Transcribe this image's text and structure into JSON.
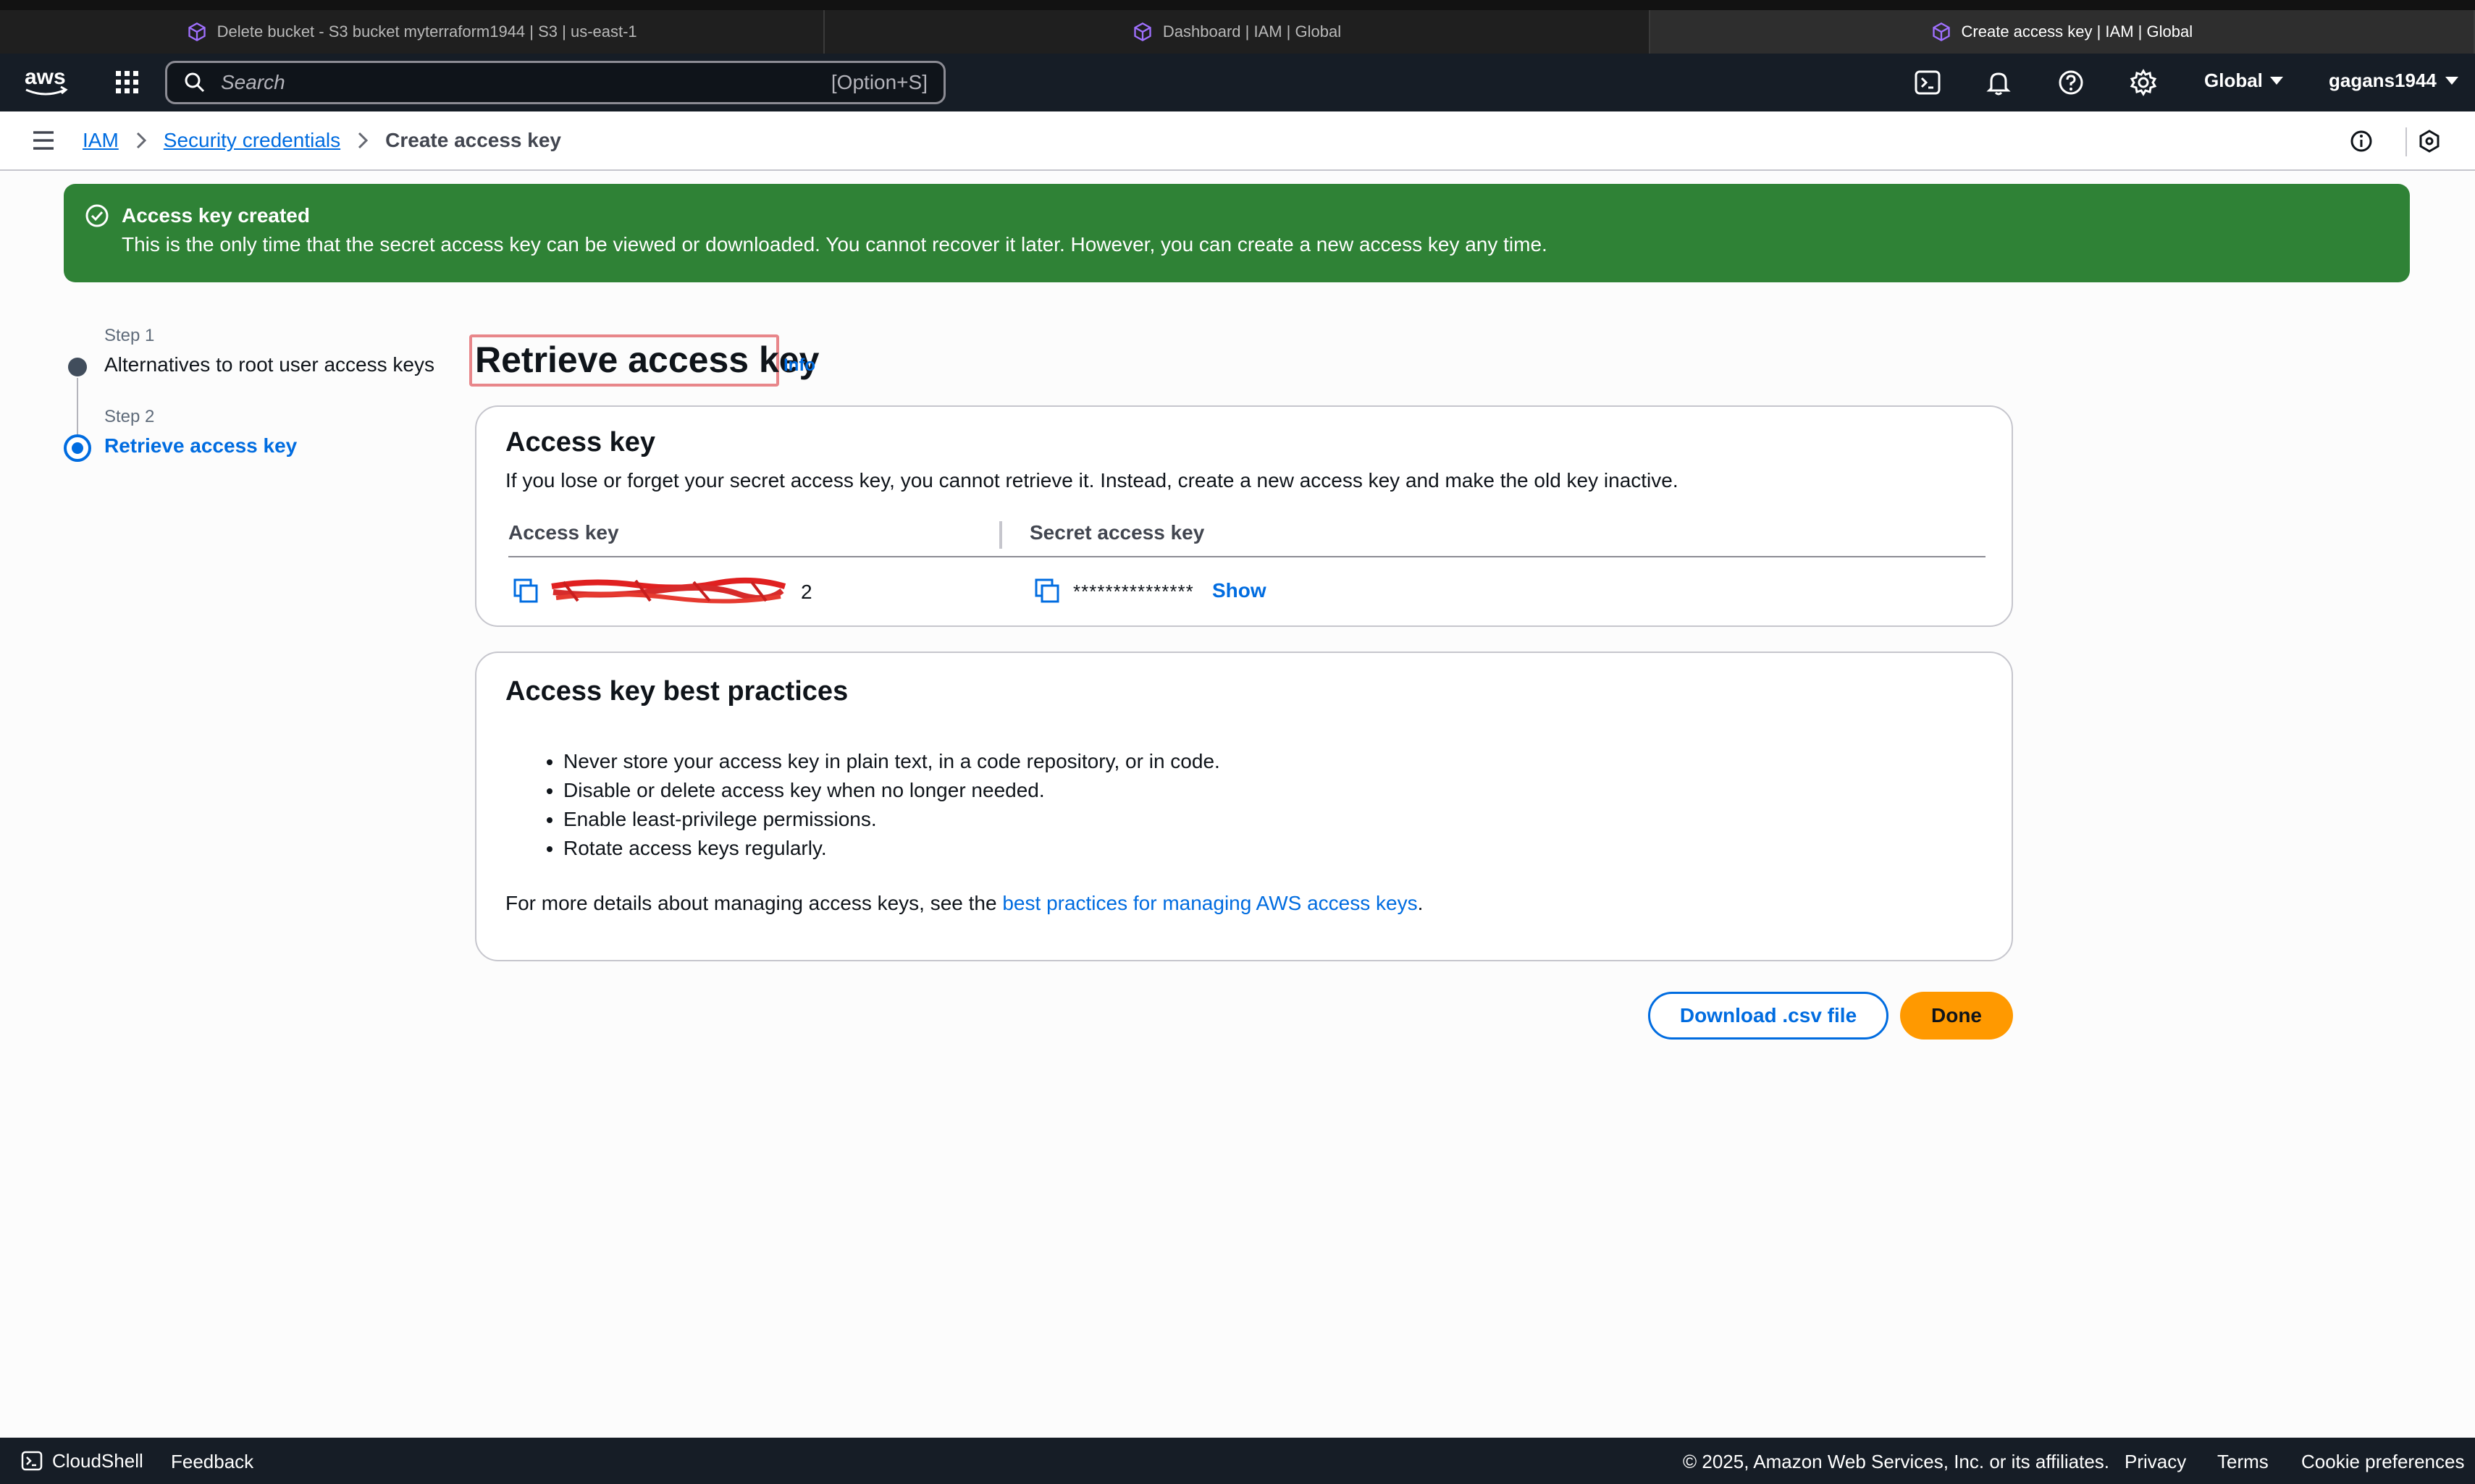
{
  "browser": {
    "tabs": [
      {
        "title": "Delete bucket - S3 bucket myterraform1944 | S3 | us-east-1",
        "active": false
      },
      {
        "title": "Dashboard | IAM | Global",
        "active": false
      },
      {
        "title": "Create access key | IAM | Global",
        "active": true
      }
    ]
  },
  "topnav": {
    "logo": "aws",
    "search_placeholder": "Search",
    "search_shortcut": "[Option+S]",
    "region": "Global",
    "account": "gagans1944",
    "icons": [
      "grid-icon",
      "cloudshell-icon",
      "bell-icon",
      "help-icon",
      "gear-icon"
    ]
  },
  "breadcrumb": {
    "items": [
      "IAM",
      "Security credentials"
    ],
    "current": "Create access key"
  },
  "flash": {
    "title": "Access key created",
    "message": "This is the only time that the secret access key can be viewed or downloaded. You cannot recover it later. However, you can create a new access key any time."
  },
  "steps": [
    {
      "label": "Step 1",
      "title": "Alternatives to root user access keys",
      "active": false
    },
    {
      "label": "Step 2",
      "title": "Retrieve access key",
      "active": true
    }
  ],
  "page": {
    "title": "Retrieve access key",
    "info_link": "Info"
  },
  "access_key_panel": {
    "title": "Access key",
    "description": "If you lose or forget your secret access key, you cannot retrieve it. Instead, create a new access key and make the old key inactive.",
    "columns": [
      "Access key",
      "Secret access key"
    ],
    "access_key_value_suffix": "2",
    "secret_value": "***************",
    "show_link": "Show"
  },
  "best_practices": {
    "title": "Access key best practices",
    "items": [
      "Never store your access key in plain text, in a code repository, or in code.",
      "Disable or delete access key when no longer needed.",
      "Enable least-privilege permissions.",
      "Rotate access keys regularly."
    ],
    "more_prefix": "For more details about managing access keys, see the ",
    "more_link": "best practices for managing AWS access keys",
    "more_suffix": "."
  },
  "actions": {
    "download": "Download .csv file",
    "done": "Done"
  },
  "footer": {
    "cloudshell": "CloudShell",
    "feedback": "Feedback",
    "copyright": "© 2025, Amazon Web Services, Inc. or its affiliates.",
    "privacy": "Privacy",
    "terms": "Terms",
    "cookies": "Cookie preferences"
  },
  "colors": {
    "success": "#2f8236",
    "link": "#006ce0",
    "primary_button": "#ff9900",
    "nav_bg": "#161d26"
  }
}
